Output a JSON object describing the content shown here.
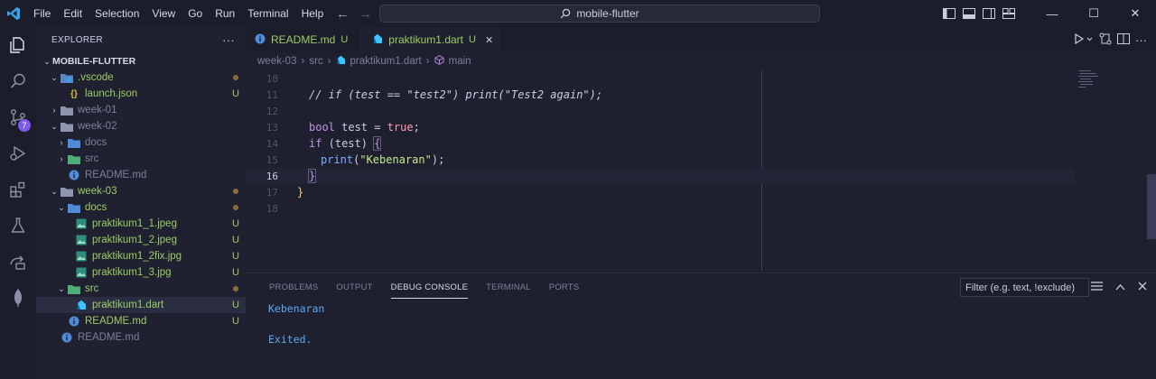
{
  "menu": [
    "File",
    "Edit",
    "Selection",
    "View",
    "Go",
    "Run",
    "Terminal",
    "Help"
  ],
  "command_center": "mobile-flutter",
  "window_controls": {
    "minimize": "—",
    "maximize": "☐",
    "close": "✕"
  },
  "activity_badge": "7",
  "sidebar": {
    "header": "EXPLORER",
    "more": "···",
    "root": "MOBILE-FLUTTER",
    "items": [
      {
        "label": ".vscode",
        "status": "dot"
      },
      {
        "label": "launch.json",
        "status": "U"
      },
      {
        "label": "week-01",
        "status": ""
      },
      {
        "label": "week-02",
        "status": ""
      },
      {
        "label": "docs",
        "status": ""
      },
      {
        "label": "src",
        "status": ""
      },
      {
        "label": "README.md",
        "status": ""
      },
      {
        "label": "week-03",
        "status": "dot"
      },
      {
        "label": "docs",
        "status": "dot"
      },
      {
        "label": "praktikum1_1.jpeg",
        "status": "U"
      },
      {
        "label": "praktikum1_2.jpeg",
        "status": "U"
      },
      {
        "label": "praktikum1_2fix.jpg",
        "status": "U"
      },
      {
        "label": "praktikum1_3.jpg",
        "status": "U"
      },
      {
        "label": "src",
        "status": "dot"
      },
      {
        "label": "praktikum1.dart",
        "status": "U"
      },
      {
        "label": "README.md",
        "status": "U"
      },
      {
        "label": "README.md",
        "status": ""
      }
    ]
  },
  "tabs": [
    {
      "label": "README.md",
      "status": "U"
    },
    {
      "label": "praktikum1.dart",
      "status": "U",
      "close": "✕"
    }
  ],
  "breadcrumb": [
    "week-03",
    "src",
    "praktikum1.dart",
    "main"
  ],
  "code": {
    "lines": [
      {
        "n": "10"
      },
      {
        "n": "11",
        "text": "// if (test == \"test2\") print(\"Test2 again\");"
      },
      {
        "n": "12"
      },
      {
        "n": "13",
        "t1": "bool",
        "t2": " test = ",
        "t3": "true",
        "t4": ";"
      },
      {
        "n": "14",
        "t1": "if",
        "t2": " (test) ",
        "t3": "{"
      },
      {
        "n": "15",
        "t1": "print",
        "t2": "(",
        "t3": "\"Kebenaran\"",
        "t4": ");"
      },
      {
        "n": "16",
        "text": "}"
      },
      {
        "n": "17",
        "text": "}"
      },
      {
        "n": "18"
      }
    ]
  },
  "panel": {
    "tabs": [
      "PROBLEMS",
      "OUTPUT",
      "DEBUG CONSOLE",
      "TERMINAL",
      "PORTS"
    ],
    "active_tab": "DEBUG CONSOLE",
    "filter_placeholder": "Filter (e.g. text, !exclude)",
    "output": [
      "Kebenaran",
      "",
      "Exited."
    ]
  },
  "colors": {
    "accent": "#7f5af0",
    "untracked": "#9ccc65",
    "console": "#5fa8f0"
  }
}
